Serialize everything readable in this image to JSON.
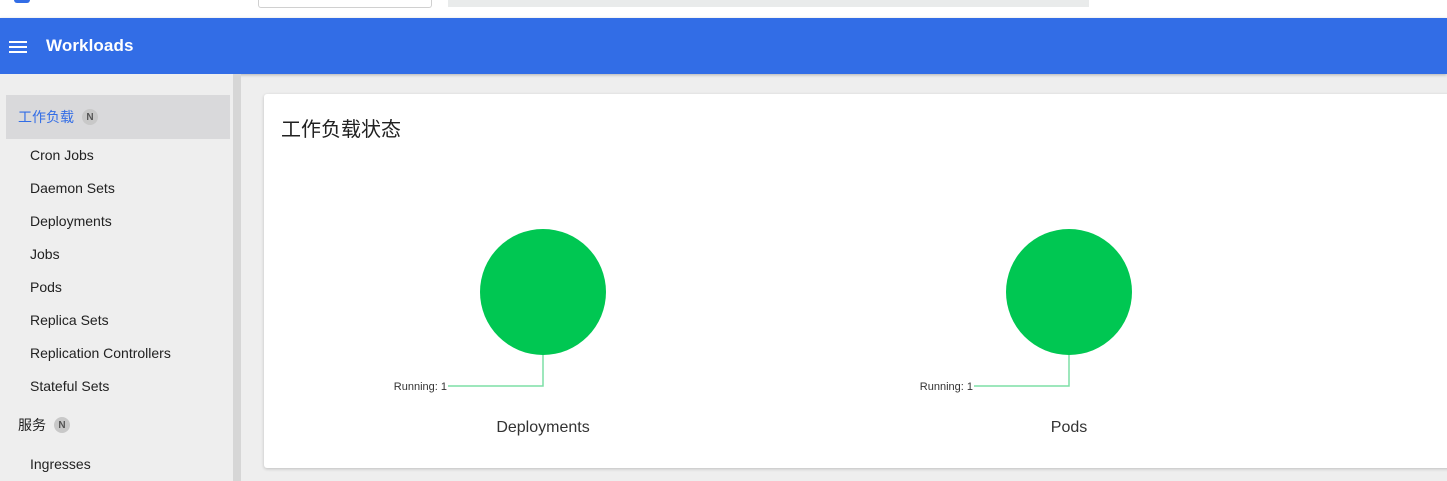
{
  "app": {
    "toolbar_title": "Workloads",
    "accent_color": "#326de6"
  },
  "sidebar": {
    "sections": [
      {
        "label": "工作负载",
        "badge": "N",
        "active": true,
        "items": [
          "Cron Jobs",
          "Daemon Sets",
          "Deployments",
          "Jobs",
          "Pods",
          "Replica Sets",
          "Replication Controllers",
          "Stateful Sets"
        ]
      },
      {
        "label": "服务",
        "badge": "N",
        "active": false,
        "items": [
          "Ingresses"
        ]
      }
    ]
  },
  "main": {
    "card_title": "工作负载状态",
    "charts": [
      {
        "title": "Deployments",
        "slices": [
          {
            "label": "Running: 1",
            "value": 1,
            "color": "#00c752"
          }
        ]
      },
      {
        "title": "Pods",
        "slices": [
          {
            "label": "Running: 1",
            "value": 1,
            "color": "#00c752"
          }
        ]
      }
    ]
  },
  "chart_data": [
    {
      "type": "pie",
      "title": "Deployments",
      "categories": [
        "Running"
      ],
      "values": [
        1
      ],
      "labels": [
        "Running: 1"
      ],
      "colors": [
        "#00c752"
      ]
    },
    {
      "type": "pie",
      "title": "Pods",
      "categories": [
        "Running"
      ],
      "values": [
        1
      ],
      "labels": [
        "Running: 1"
      ],
      "colors": [
        "#00c752"
      ]
    }
  ]
}
